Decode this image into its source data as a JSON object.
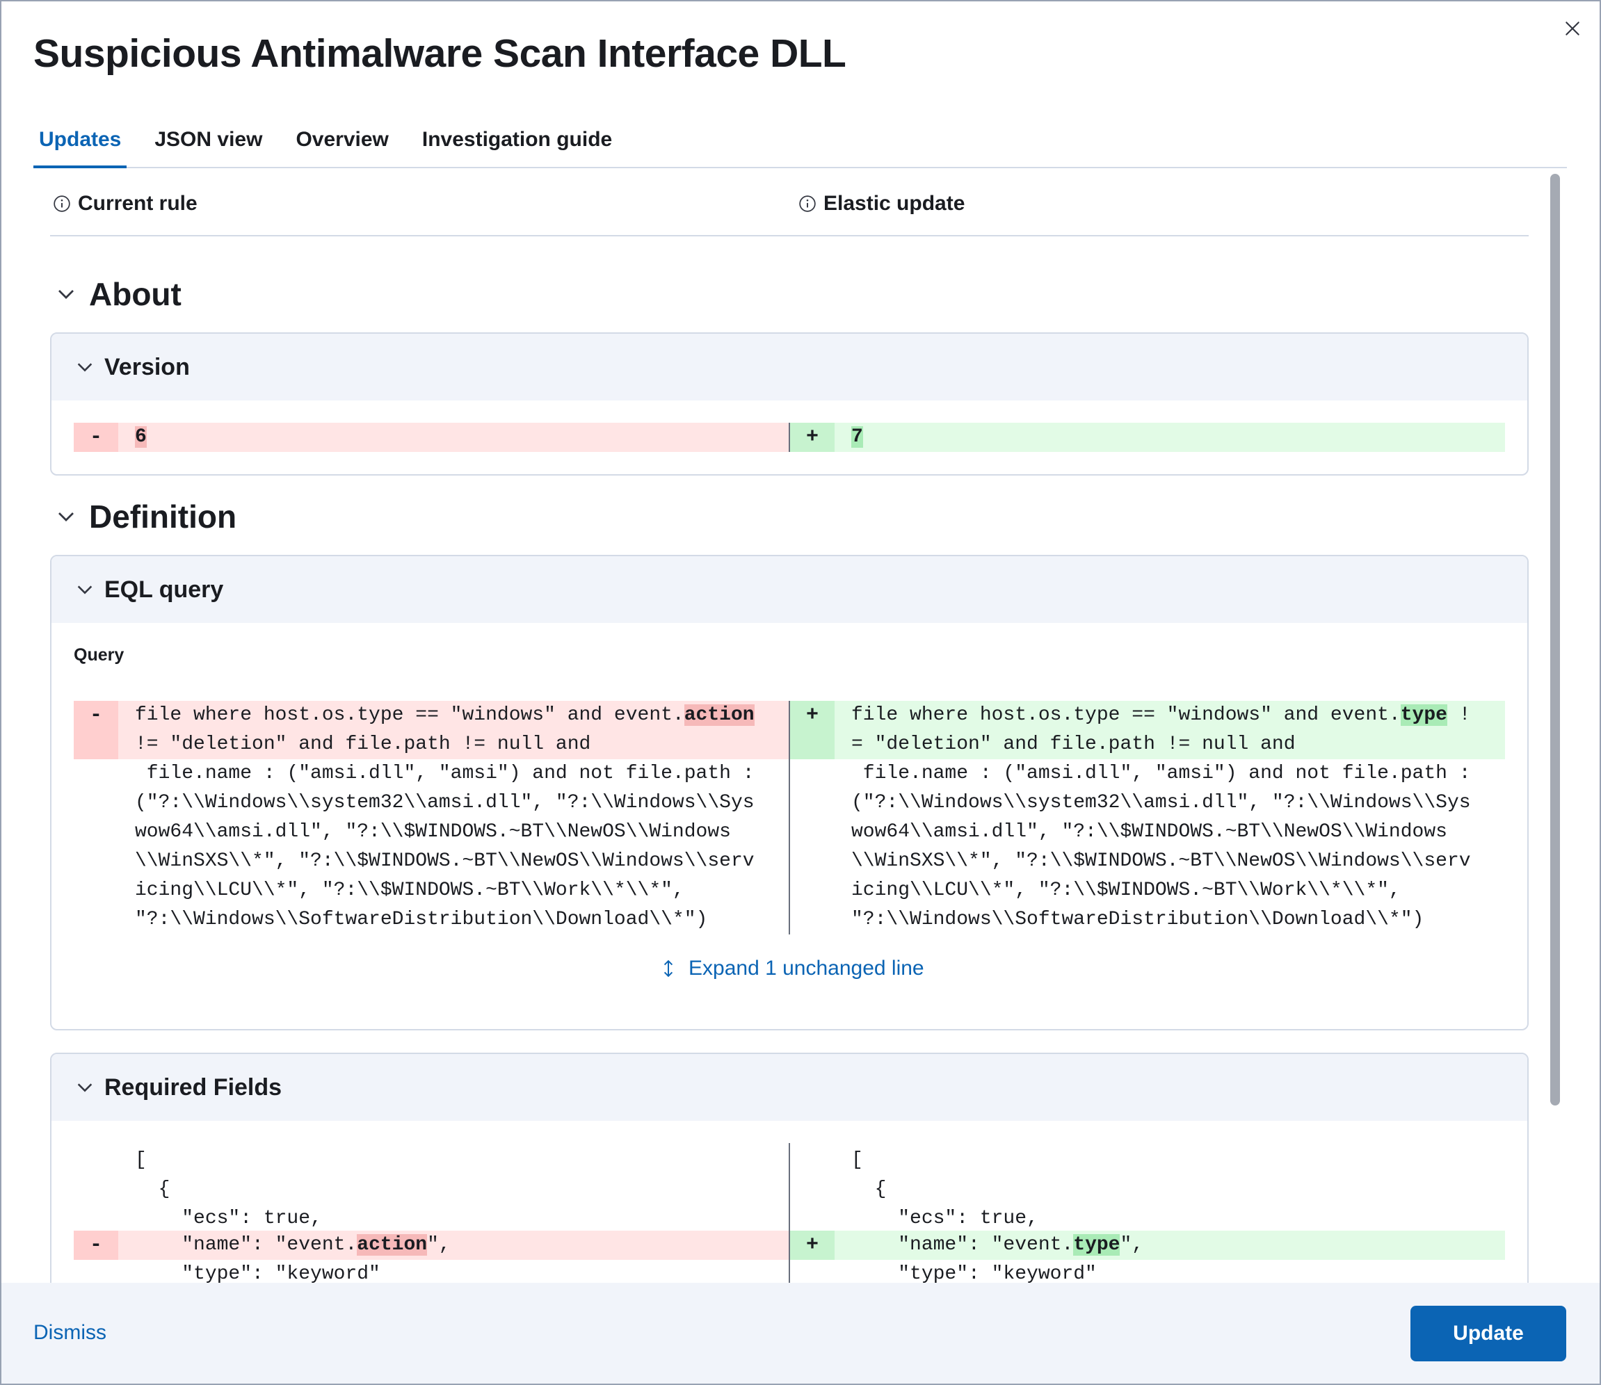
{
  "flyout": {
    "title": "Suspicious Antimalware Scan Interface DLL",
    "close_icon": "close-icon"
  },
  "tabs": [
    {
      "label": "Updates",
      "active": true
    },
    {
      "label": "JSON view",
      "active": false
    },
    {
      "label": "Overview",
      "active": false
    },
    {
      "label": "Investigation guide",
      "active": false
    }
  ],
  "columns": {
    "left": "Current rule",
    "right": "Elastic update",
    "icon": "info-icon"
  },
  "sections": {
    "about": "About",
    "definition": "Definition"
  },
  "version_panel": {
    "title": "Version",
    "old_value": "6",
    "new_value": "7",
    "minus": "-",
    "plus": "+"
  },
  "eql_panel": {
    "title": "EQL query",
    "query_label": "Query",
    "left": {
      "line1_pre": "file where host.os.type == \"windows\" and event.",
      "line1_hl": "action",
      "line2": "!= \"deletion\" and file.path != null and",
      "rest": [
        " file.name : (\"amsi.dll\", \"amsi\") and not file.path :",
        "(\"?:\\\\Windows\\\\system32\\\\amsi.dll\", \"?:\\\\Windows\\\\Sys",
        "wow64\\\\amsi.dll\", \"?:\\\\$WINDOWS.~BT\\\\NewOS\\\\Windows",
        "\\\\WinSXS\\\\*\", \"?:\\\\$WINDOWS.~BT\\\\NewOS\\\\Windows\\\\serv",
        "icing\\\\LCU\\\\*\", \"?:\\\\$WINDOWS.~BT\\\\Work\\\\*\\\\*\",",
        "\"?:\\\\Windows\\\\SoftwareDistribution\\\\Download\\\\*\")"
      ]
    },
    "right": {
      "line1_pre": "file where host.os.type == \"windows\" and event.",
      "line1_hl": "type",
      "line1_post": " !",
      "line2": "= \"deletion\" and file.path != null and",
      "rest": [
        " file.name : (\"amsi.dll\", \"amsi\") and not file.path :",
        "(\"?:\\\\Windows\\\\system32\\\\amsi.dll\", \"?:\\\\Windows\\\\Sys",
        "wow64\\\\amsi.dll\", \"?:\\\\$WINDOWS.~BT\\\\NewOS\\\\Windows",
        "\\\\WinSXS\\\\*\", \"?:\\\\$WINDOWS.~BT\\\\NewOS\\\\Windows\\\\serv",
        "icing\\\\LCU\\\\*\", \"?:\\\\$WINDOWS.~BT\\\\Work\\\\*\\\\*\",",
        "\"?:\\\\Windows\\\\SoftwareDistribution\\\\Download\\\\*\")"
      ]
    },
    "expand_label": "Expand 1 unchanged line",
    "expand_icon": "expand-vertical-icon"
  },
  "required_fields_panel": {
    "title": "Required Fields",
    "lines_common": [
      "[",
      "  {",
      "    \"ecs\": true,"
    ],
    "left_name_pre": "    \"name\": \"event.",
    "left_name_hl": "action",
    "left_name_post": "\",",
    "right_name_pre": "    \"name\": \"event.",
    "right_name_hl": "type",
    "right_name_post": "\",",
    "type_line": "    \"type\": \"keyword\""
  },
  "footer": {
    "dismiss_label": "Dismiss",
    "update_label": "Update"
  },
  "colors": {
    "accent": "#0b64b4",
    "deleted_bg": "#ffe5e5",
    "added_bg": "#e2fbe6"
  }
}
